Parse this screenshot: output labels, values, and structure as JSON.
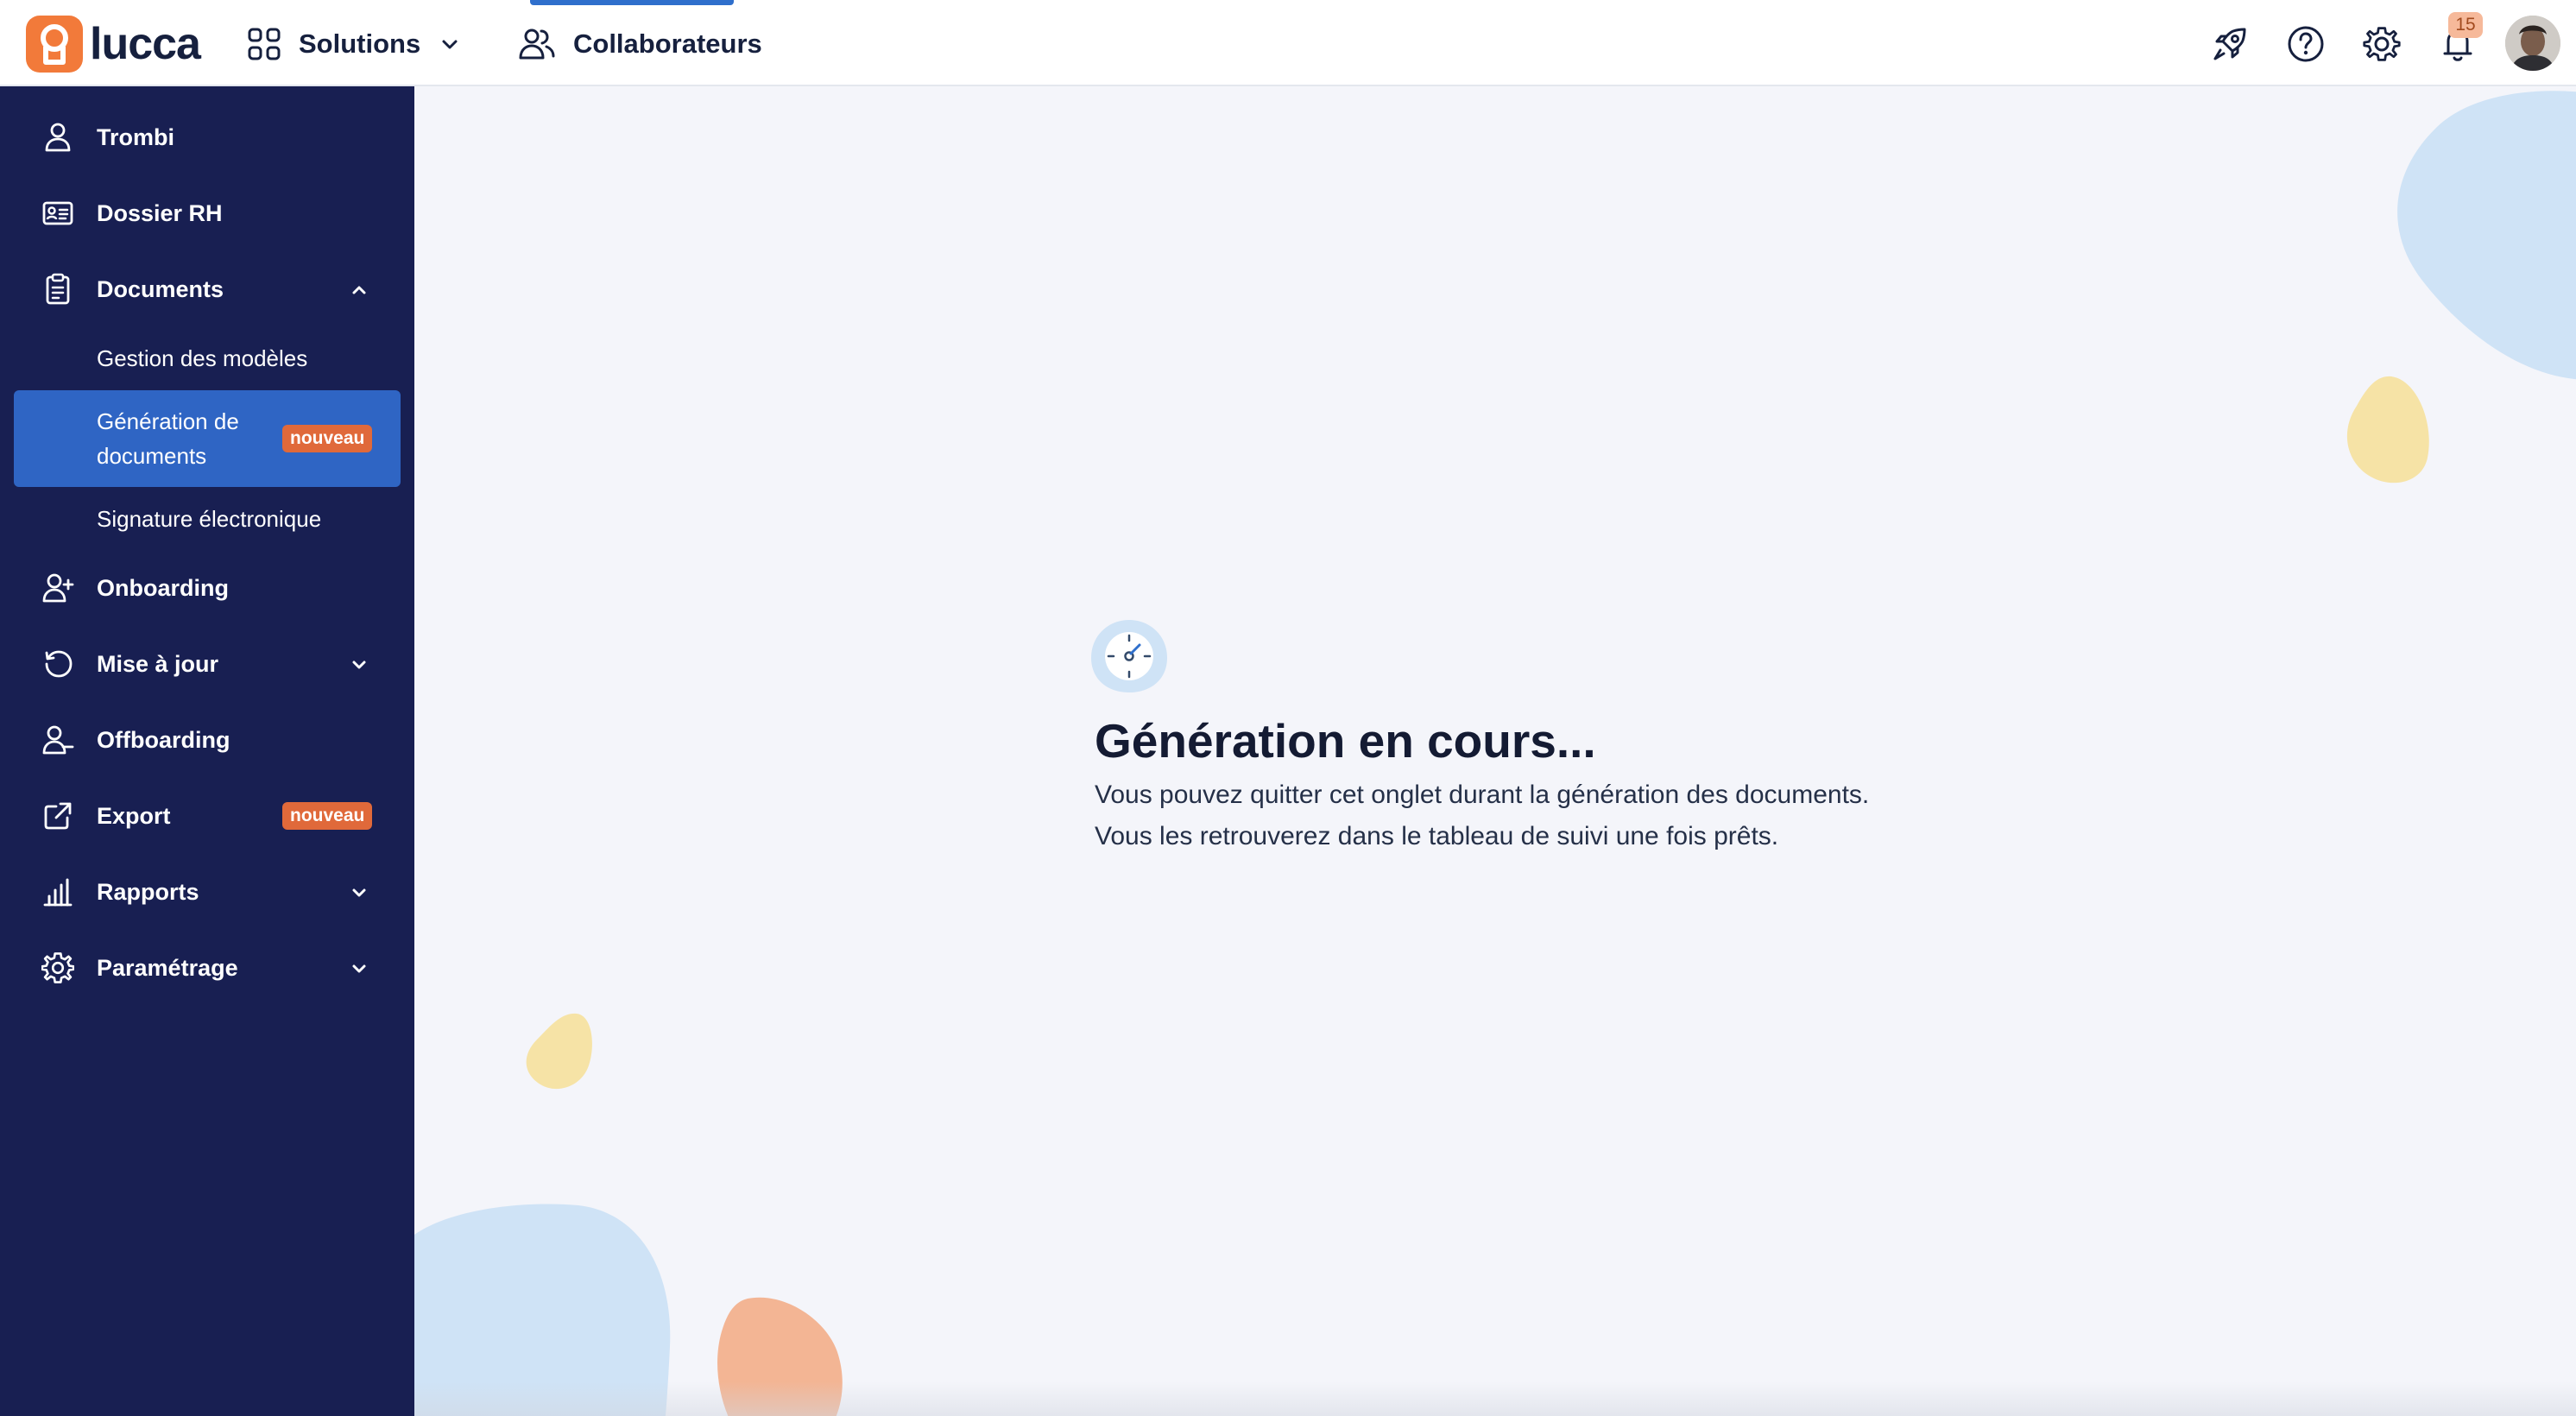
{
  "header": {
    "brand": "lucca",
    "solutions_label": "Solutions",
    "collaborateurs_label": "Collaborateurs",
    "notification_count": "15",
    "icons": [
      "rocket-icon",
      "help-icon",
      "gear-icon",
      "bell-icon"
    ]
  },
  "sidebar": {
    "items": [
      {
        "label": "Trombi",
        "icon": "user-icon"
      },
      {
        "label": "Dossier RH",
        "icon": "id-card-icon"
      },
      {
        "label": "Documents",
        "icon": "clipboard-icon",
        "expanded": true,
        "children": [
          {
            "label": "Gestion des modèles"
          },
          {
            "label": "Génération de documents",
            "badge": "nouveau",
            "active": true
          },
          {
            "label": "Signature électronique"
          }
        ]
      },
      {
        "label": "Onboarding",
        "icon": "user-plus-icon"
      },
      {
        "label": "Mise à jour",
        "icon": "refresh-icon",
        "expandable": true
      },
      {
        "label": "Offboarding",
        "icon": "user-minus-icon"
      },
      {
        "label": "Export",
        "icon": "external-link-icon",
        "badge": "nouveau"
      },
      {
        "label": "Rapports",
        "icon": "bar-chart-icon",
        "expandable": true
      },
      {
        "label": "Paramétrage",
        "icon": "settings-icon",
        "expandable": true
      }
    ]
  },
  "main": {
    "title": "Génération en cours...",
    "line1": "Vous pouvez quitter cet onglet durant la génération des documents.",
    "line2": "Vous les retrouverez dans le tableau de suivi une fois prêts."
  },
  "colors": {
    "sidebar_bg": "#181f52",
    "active_item": "#2f65c4",
    "badge": "#e0693a",
    "brand": "#f27a3a"
  }
}
